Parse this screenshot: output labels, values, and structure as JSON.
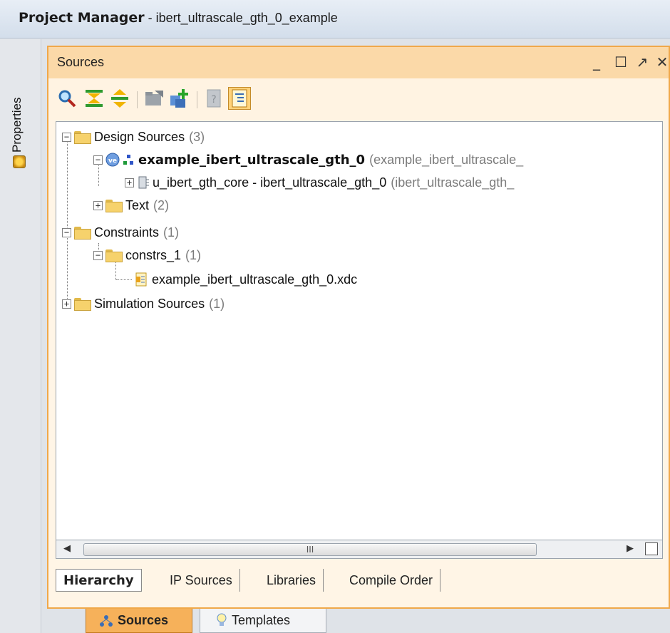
{
  "title_bar": {
    "app": "Project Manager",
    "project": " - ibert_ultrascale_gth_0_example"
  },
  "side_tabs": {
    "properties": "Properties"
  },
  "panel": {
    "title": "Sources",
    "controls": {
      "minimize": "_",
      "maximize": "☐",
      "restore": "↗",
      "close": "✕"
    },
    "toolbar": {
      "buttons": [
        {
          "icon": "search-icon"
        },
        {
          "icon": "collapse-all-icon"
        },
        {
          "icon": "expand-all-icon"
        },
        {
          "icon": "open-folder-icon"
        },
        {
          "icon": "add-sources-icon"
        },
        {
          "icon": "document-properties-icon"
        },
        {
          "icon": "show-hierarchy-icon",
          "active": true
        }
      ]
    },
    "tree": {
      "design_sources": {
        "label": "Design Sources",
        "count": "(3)"
      },
      "top_module": {
        "label": "example_ibert_ultrascale_gth_0",
        "detail": "(example_ibert_ultrascale_"
      },
      "core_instance": {
        "label": "u_ibert_gth_core - ibert_ultrascale_gth_0",
        "detail": "(ibert_ultrascale_gth_"
      },
      "text": {
        "label": "Text",
        "count": "(2)"
      },
      "constraints": {
        "label": "Constraints",
        "count": "(1)"
      },
      "constrs_1": {
        "label": "constrs_1",
        "count": "(1)"
      },
      "xdc_file": {
        "label": "example_ibert_ultrascale_gth_0.xdc"
      },
      "simulation_sources": {
        "label": "Simulation Sources",
        "count": "(1)"
      }
    },
    "scrollbar": {
      "grip": "III"
    },
    "view_tabs": [
      {
        "label": "Hierarchy",
        "selected": true
      },
      {
        "label": "IP Sources"
      },
      {
        "label": "Libraries"
      },
      {
        "label": "Compile Order"
      }
    ]
  },
  "window_tabs": [
    {
      "label": "Sources",
      "selected": true
    },
    {
      "label": "Templates"
    }
  ],
  "colors": {
    "panel_border": "#f0a84a",
    "panel_header": "#fbd9a8",
    "selected_tab": "#f6b15a"
  }
}
